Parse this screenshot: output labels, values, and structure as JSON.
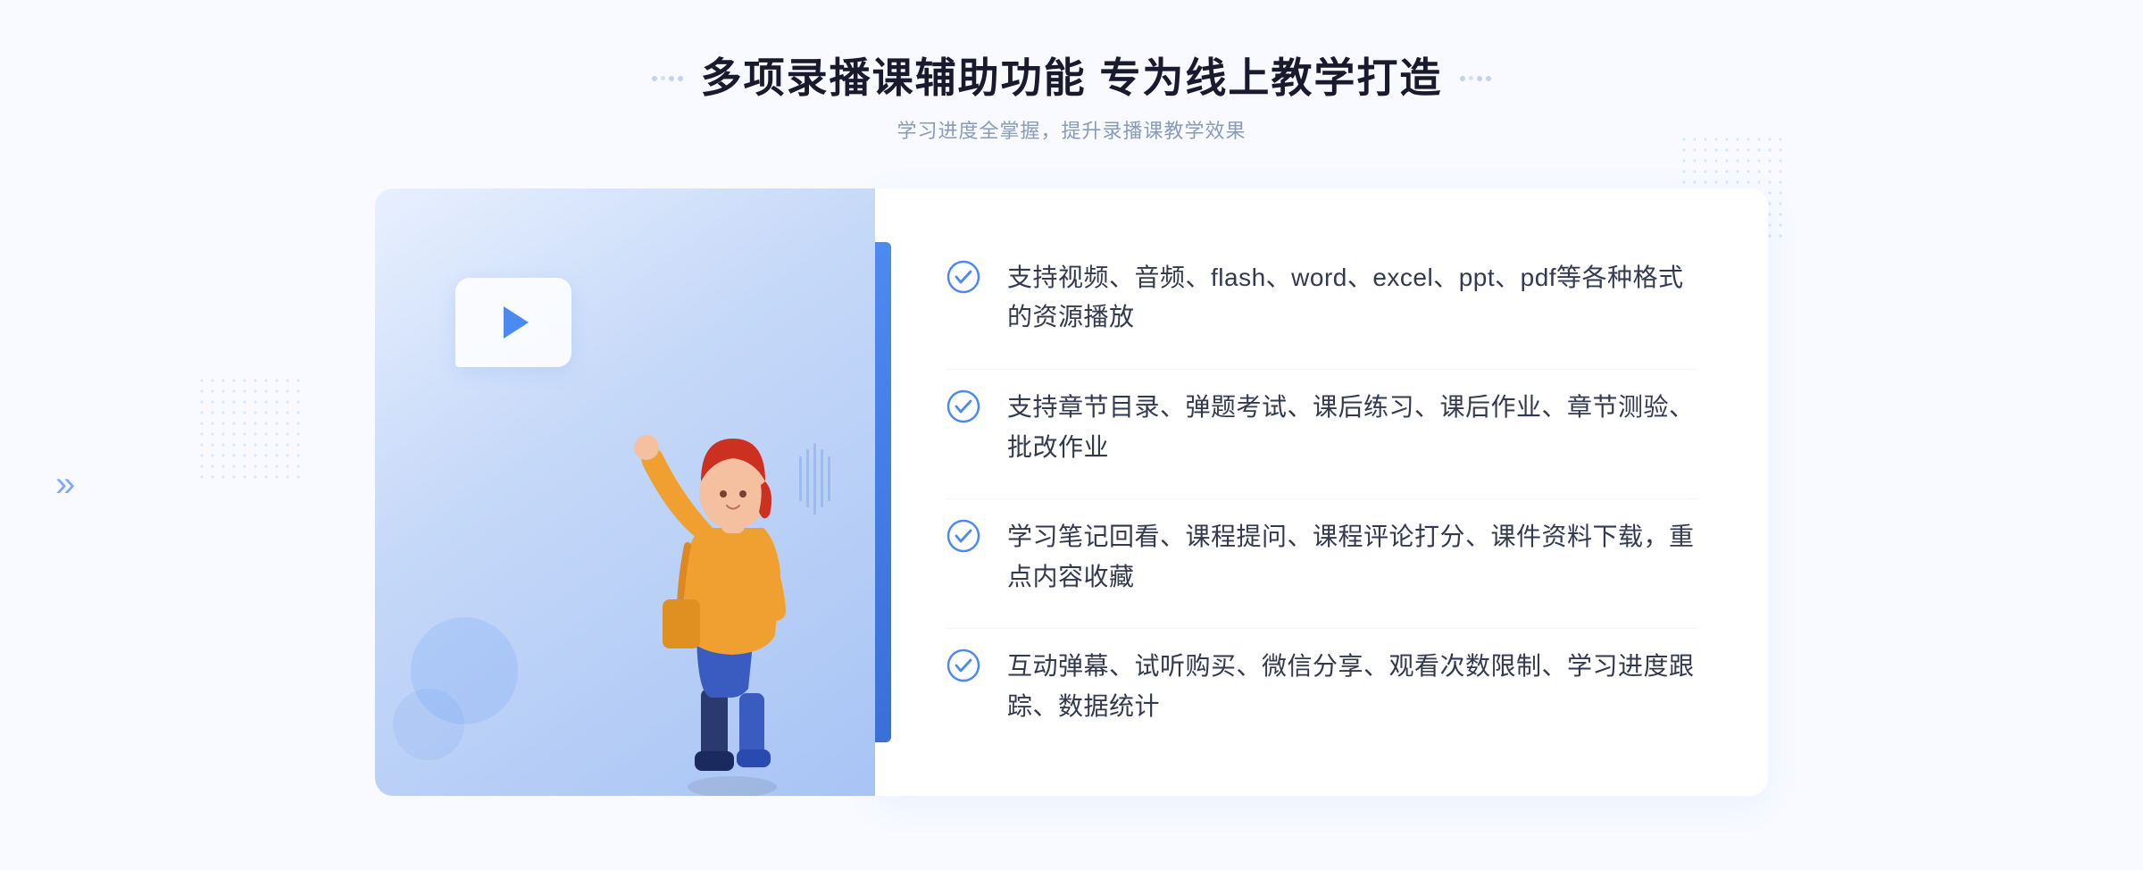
{
  "page": {
    "background_color": "#f8faff",
    "title": "多项录播课辅助功能 专为线上教学打造",
    "subtitle": "学习进度全掌握，提升录播课教学效果",
    "features": [
      {
        "id": "feature-1",
        "text": "支持视频、音频、flash、word、excel、ppt、pdf等各种格式的资源播放"
      },
      {
        "id": "feature-2",
        "text": "支持章节目录、弹题考试、课后练习、课后作业、章节测验、批改作业"
      },
      {
        "id": "feature-3",
        "text": "学习笔记回看、课程提问、课程评论打分、课件资料下载，重点内容收藏"
      },
      {
        "id": "feature-4",
        "text": "互动弹幕、试听购买、微信分享、观看次数限制、学习进度跟踪、数据统计"
      }
    ],
    "accent_color": "#4d8af0",
    "check_color": "#4d8af0",
    "title_color": "#1a1a2e",
    "subtitle_color": "#8a9bb8",
    "feature_text_color": "#333a4d"
  }
}
